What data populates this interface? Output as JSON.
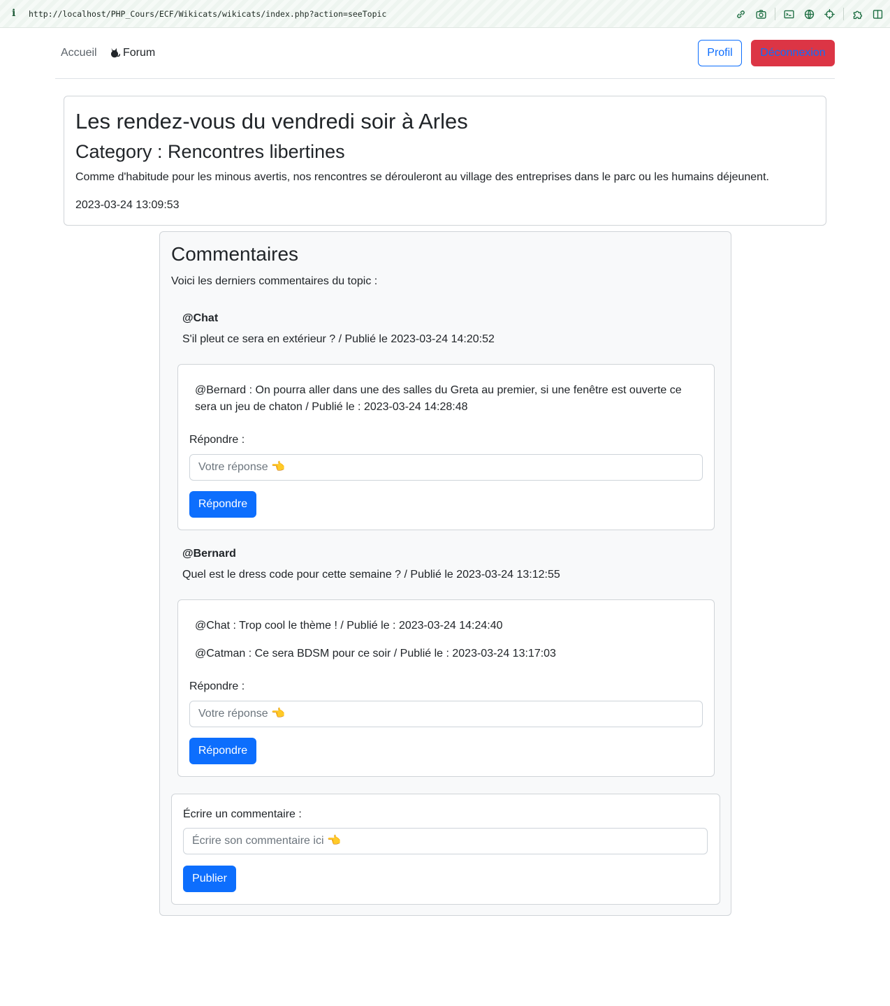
{
  "browser": {
    "info_glyph": "i",
    "url": "http://localhost/PHP_Cours/ECF/Wikicats/wikicats/index.php?action=seeTopic"
  },
  "nav": {
    "home_label": "Accueil",
    "forum_label": "Forum",
    "profile_label": "Profil",
    "logout_label": "Déconnexion"
  },
  "topic": {
    "title": "Les rendez-vous du vendredi soir à Arles",
    "category": "Category : Rencontres libertines",
    "description": "Comme d'habitude pour les minous avertis, nos rencontres se dérouleront au village des entreprises dans le parc ou les humains déjeunent.",
    "date": "2023-03-24 13:09:53"
  },
  "comments": {
    "heading": "Commentaires",
    "intro": "Voici les derniers commentaires du topic :",
    "items": [
      {
        "author": "@Chat",
        "text": "S'il pleut ce sera en extérieur ? / Publié le 2023-03-24 14:20:52",
        "replies": [
          "@Bernard : On pourra aller dans une des salles du Greta au premier, si une fenêtre est ouverte ce sera un jeu de chaton / Publié le : 2023-03-24 14:28:48"
        ],
        "reply_label": "Répondre :",
        "reply_placeholder": "Votre réponse 👈",
        "reply_button": "Répondre"
      },
      {
        "author": "@Bernard",
        "text": "Quel est le dress code pour cette semaine ? / Publié le 2023-03-24 13:12:55",
        "replies": [
          "@Chat : Trop cool le thème ! / Publié le : 2023-03-24 14:24:40",
          "@Catman : Ce sera BDSM pour ce soir / Publié le : 2023-03-24 13:17:03"
        ],
        "reply_label": "Répondre :",
        "reply_placeholder": "Votre réponse 👈",
        "reply_button": "Répondre"
      }
    ],
    "new_comment": {
      "label": "Écrire un commentaire :",
      "placeholder": "Écrire son commentaire ici 👈",
      "button": "Publier"
    }
  },
  "colors": {
    "primary": "#0d6efd",
    "danger": "#dc3545",
    "text": "#212529",
    "panel_bg": "#f8f9fa",
    "browser_icon": "#1d6e42"
  },
  "icons": [
    "link-icon",
    "camera-icon",
    "terminal-icon",
    "globe-icon",
    "crosshair-icon",
    "extensions-icon",
    "sidebar-icon",
    "cat-icon"
  ]
}
